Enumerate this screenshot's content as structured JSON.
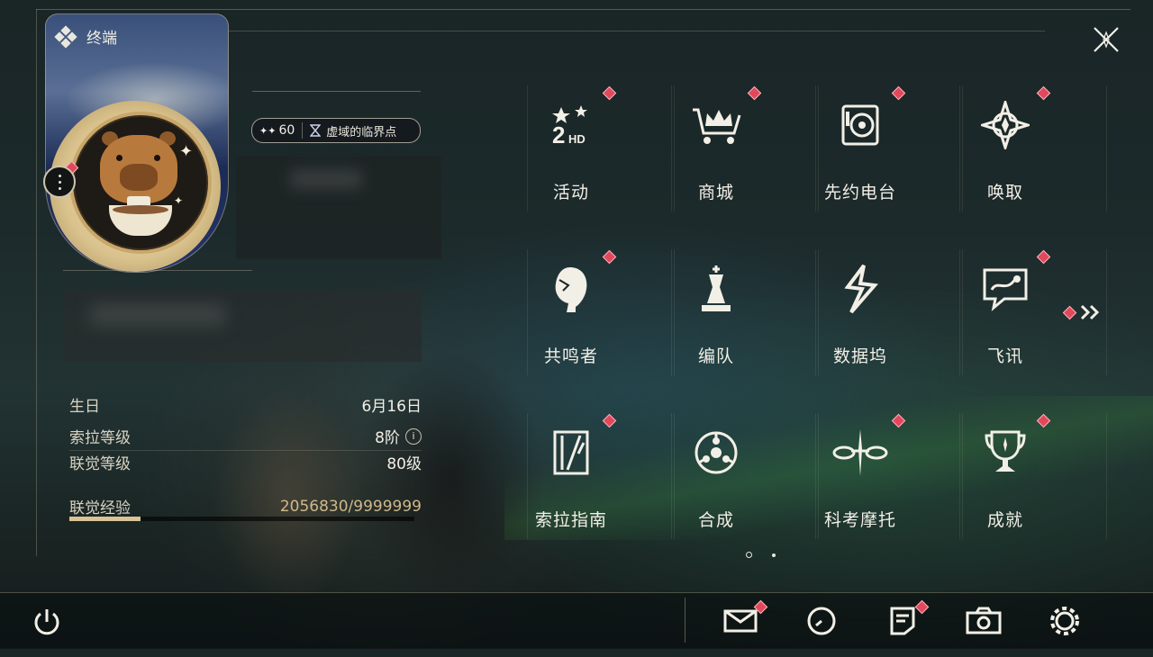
{
  "header": {
    "title": "终端"
  },
  "profile": {
    "level_prefix": "✦✦",
    "level": "60",
    "zone_icon": "hourglass-icon",
    "zone_name": "虚域的临界点"
  },
  "info": {
    "birthday_label": "生日",
    "birthday_value": "6月16日",
    "sola_label": "索拉等级",
    "sola_value": "8阶",
    "sola_info_glyph": "i",
    "union_label": "联觉等级",
    "union_value": "80级",
    "exp_label": "联觉经验",
    "exp_value": "2056830/9999999",
    "exp_progress": 0.2057
  },
  "menu": [
    {
      "label": "活动",
      "icon": "event-2hd-icon",
      "badge": true
    },
    {
      "label": "商城",
      "icon": "shop-cart-crown-icon",
      "badge": true
    },
    {
      "label": "先约电台",
      "icon": "radio-icon",
      "badge": true
    },
    {
      "label": "唤取",
      "icon": "convene-compass-icon",
      "badge": true
    },
    {
      "label": "共鸣者",
      "icon": "resonator-head-icon",
      "badge": true
    },
    {
      "label": "编队",
      "icon": "team-chess-icon",
      "badge": false
    },
    {
      "label": "数据坞",
      "icon": "databank-icon",
      "badge": false
    },
    {
      "label": "飞讯",
      "icon": "message-chat-icon",
      "badge": true
    },
    {
      "label": "索拉指南",
      "icon": "guidebook-icon",
      "badge": true
    },
    {
      "label": "合成",
      "icon": "synthesis-icon",
      "badge": false
    },
    {
      "label": "科考摩托",
      "icon": "motorbike-icon",
      "badge": true
    },
    {
      "label": "成就",
      "icon": "trophy-icon",
      "badge": true
    }
  ],
  "pagination": {
    "current": 1,
    "total": 2
  },
  "bottom_bar": {
    "items": [
      {
        "icon": "power-icon"
      },
      {
        "icon": "mail-icon",
        "badge": true
      },
      {
        "icon": "clock-icon",
        "badge": false
      },
      {
        "icon": "notice-icon",
        "badge": true
      },
      {
        "icon": "camera-icon",
        "badge": false
      },
      {
        "icon": "settings-gear-icon",
        "badge": false
      }
    ]
  },
  "colors": {
    "badge": "#e2485c",
    "accent_gold": "#d9c397",
    "text": "#f2efe6"
  }
}
